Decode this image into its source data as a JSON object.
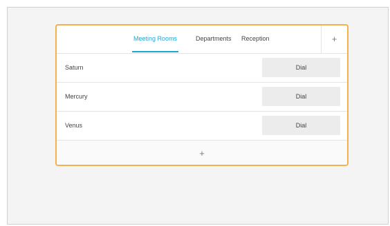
{
  "tabs": [
    {
      "label": "Meeting Rooms",
      "active": true
    },
    {
      "label": "Departments",
      "active": false
    },
    {
      "label": "Reception",
      "active": false
    }
  ],
  "tab_add_label": "+",
  "rows": [
    {
      "name": "Saturn",
      "action": "Dial"
    },
    {
      "name": "Mercury",
      "action": "Dial"
    },
    {
      "name": "Venus",
      "action": "Dial"
    }
  ],
  "footer_add_label": "+",
  "colors": {
    "accent": "#1ea7d6",
    "highlight_border": "#f5b04c",
    "button_bg": "#ececec"
  }
}
